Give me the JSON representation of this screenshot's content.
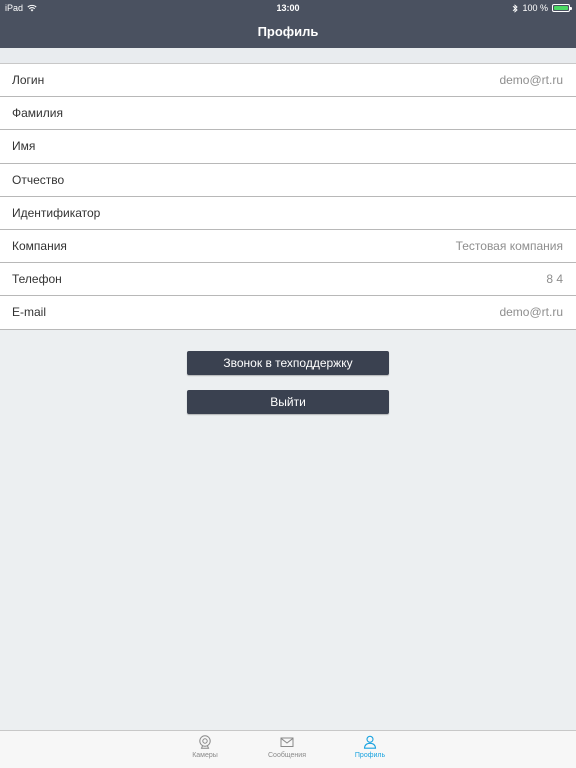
{
  "status_bar": {
    "device": "iPad",
    "time": "13:00",
    "battery": "100 %"
  },
  "header": {
    "title": "Профиль"
  },
  "profile": {
    "rows": [
      {
        "label": "Логин",
        "value": "demo@rt.ru"
      },
      {
        "label": "Фамилия",
        "value": ""
      },
      {
        "label": "Имя",
        "value": ""
      },
      {
        "label": "Отчество",
        "value": ""
      },
      {
        "label": "Идентификатор",
        "value": ""
      },
      {
        "label": "Компания",
        "value": "Тестовая компания"
      },
      {
        "label": "Телефон",
        "value": "8 4"
      },
      {
        "label": "E-mail",
        "value": "demo@rt.ru"
      }
    ]
  },
  "actions": {
    "support_label": "Звонок в техподдержку",
    "logout_label": "Выйти"
  },
  "tabs": [
    {
      "label": "Камеры",
      "icon": "camera-icon",
      "active": false
    },
    {
      "label": "Сообщения",
      "icon": "envelope-icon",
      "active": false
    },
    {
      "label": "Профиль",
      "icon": "person-icon",
      "active": true
    }
  ],
  "colors": {
    "header_bg": "#4a5160",
    "button_bg": "#3a4150",
    "active_tab": "#1aa3e0",
    "battery": "#4cd964"
  }
}
